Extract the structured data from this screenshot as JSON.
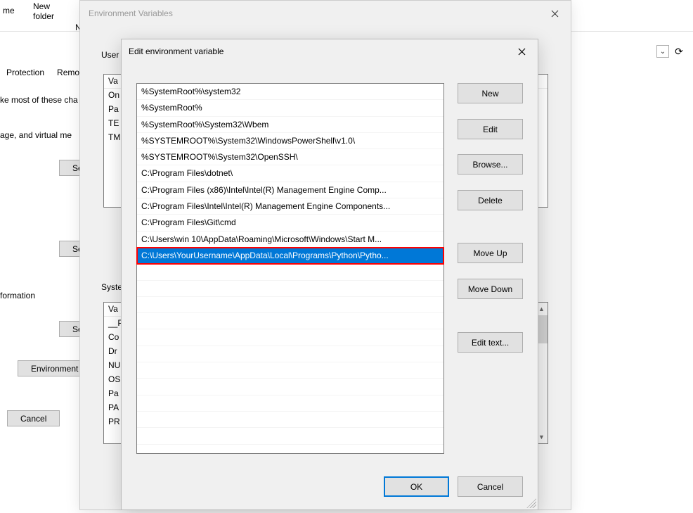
{
  "background": {
    "toolbar_label1": "me",
    "folder_label_line1": "New",
    "folder_label_line2": "folder",
    "ne_text": "Ne",
    "tabs": [
      "Protection",
      "Remote"
    ],
    "text1": "ke most of these cha",
    "text2": "age, and virtual me",
    "info": "formation",
    "set_label": "Set",
    "envv_label": "Environment V",
    "cancel_label": "Cancel"
  },
  "env_dialog": {
    "title": "Environment Variables",
    "user_group": "User",
    "sys_group": "Syste",
    "user_rows": [
      "Va",
      "On",
      "Pa",
      "TE",
      "TM"
    ],
    "sys_rows": [
      "Va",
      "__P",
      "Co",
      "Dr",
      "NU",
      "OS",
      "Pa",
      "PA",
      "PR"
    ]
  },
  "edit_dialog": {
    "title": "Edit environment variable",
    "items": [
      "%SystemRoot%\\system32",
      "%SystemRoot%",
      "%SystemRoot%\\System32\\Wbem",
      "%SYSTEMROOT%\\System32\\WindowsPowerShell\\v1.0\\",
      "%SYSTEMROOT%\\System32\\OpenSSH\\",
      "C:\\Program Files\\dotnet\\",
      "C:\\Program Files (x86)\\Intel\\Intel(R) Management Engine Comp...",
      "C:\\Program Files\\Intel\\Intel(R) Management Engine Components...",
      "C:\\Program Files\\Git\\cmd",
      "C:\\Users\\win 10\\AppData\\Roaming\\Microsoft\\Windows\\Start M...",
      "C:\\Users\\YourUsername\\AppData\\Local\\Programs\\Python\\Pytho..."
    ],
    "selected_index": 10,
    "buttons": {
      "new": "New",
      "edit": "Edit",
      "browse": "Browse...",
      "delete": "Delete",
      "move_up": "Move Up",
      "move_down": "Move Down",
      "edit_text": "Edit text...",
      "ok": "OK",
      "cancel": "Cancel"
    }
  }
}
